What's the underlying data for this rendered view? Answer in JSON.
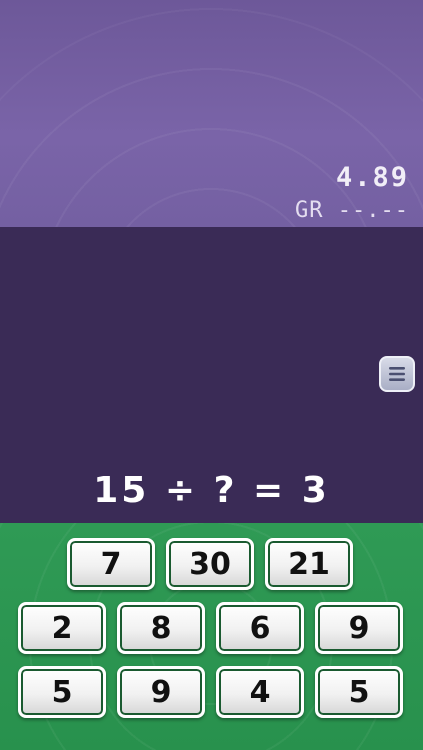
{
  "header": {
    "timer": "4.89",
    "grade": "GR --.--"
  },
  "menu": {
    "icon": "menu-icon"
  },
  "question": {
    "equation": "15 ÷ ? = 3"
  },
  "answers": {
    "row1": [
      "7",
      "30",
      "21"
    ],
    "row2": [
      "2",
      "8",
      "6",
      "9"
    ],
    "row3": [
      "5",
      "9",
      "4",
      "5"
    ]
  },
  "colors": {
    "top_band": "#7460a2",
    "middle_band": "#3a2b56",
    "bottom_band": "#2f9a55"
  }
}
